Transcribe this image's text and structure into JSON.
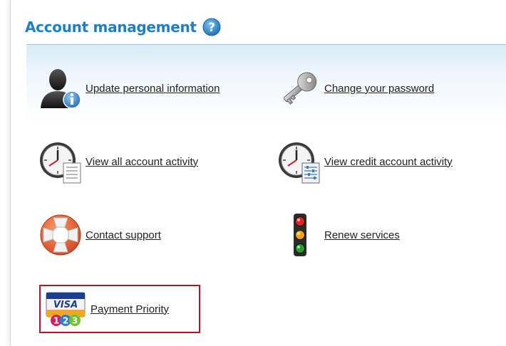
{
  "header": {
    "title": "Account management"
  },
  "items": [
    {
      "label": "Update personal information",
      "icon": "user-info-icon"
    },
    {
      "label": "Change your password",
      "icon": "key-icon"
    },
    {
      "label": "View all account activity",
      "icon": "clock-document-icon"
    },
    {
      "label": "View credit account activity",
      "icon": "clock-ledger-icon"
    },
    {
      "label": "Contact support",
      "icon": "lifebuoy-icon"
    },
    {
      "label": "Renew services",
      "icon": "traffic-light-icon"
    },
    {
      "label": "Payment Priority",
      "icon": "visa-card-123-icon"
    }
  ],
  "payment_icon": {
    "card_text": "VISA",
    "badges": [
      "1",
      "2",
      "3"
    ]
  },
  "colors": {
    "title": "#1f7fc4",
    "highlight_border": "#b0182a",
    "panel_top": "#d8ebf7"
  }
}
